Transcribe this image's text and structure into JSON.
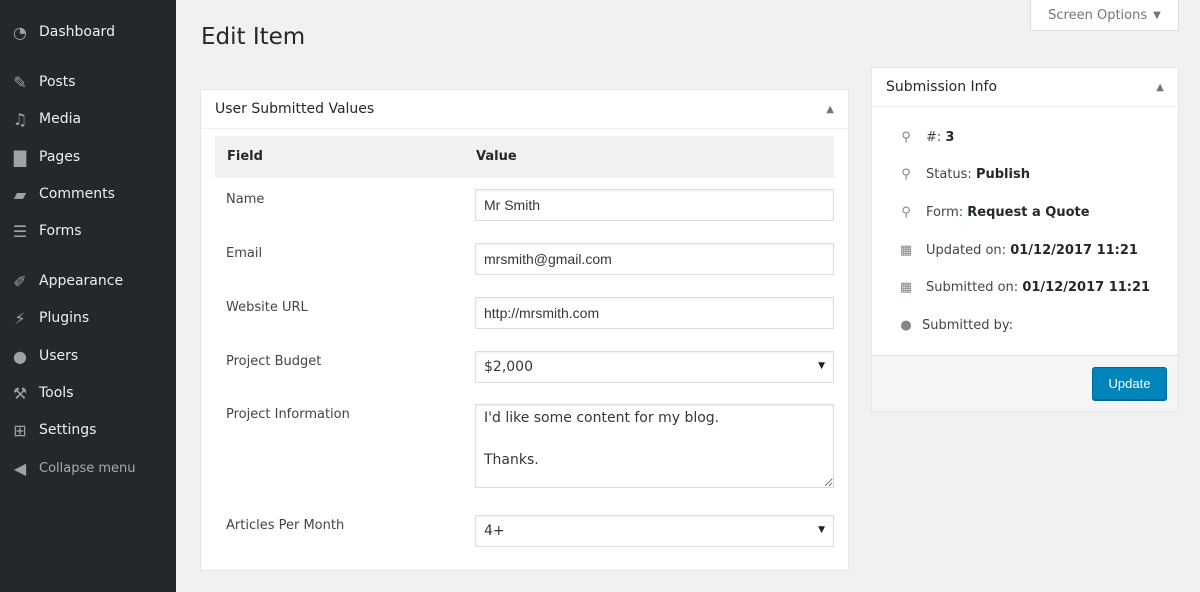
{
  "sidebar": {
    "items": [
      {
        "label": "Dashboard",
        "icon": "dashboard-icon"
      },
      {
        "label": "Posts",
        "icon": "pin-icon"
      },
      {
        "label": "Media",
        "icon": "media-icon"
      },
      {
        "label": "Pages",
        "icon": "pages-icon"
      },
      {
        "label": "Comments",
        "icon": "comment-icon"
      },
      {
        "label": "Forms",
        "icon": "forms-icon"
      },
      {
        "label": "Appearance",
        "icon": "brush-icon"
      },
      {
        "label": "Plugins",
        "icon": "plug-icon"
      },
      {
        "label": "Users",
        "icon": "user-icon"
      },
      {
        "label": "Tools",
        "icon": "wrench-icon"
      },
      {
        "label": "Settings",
        "icon": "settings-icon"
      }
    ],
    "collapse": "Collapse menu"
  },
  "page_title": "Edit Item",
  "screen_options": "Screen Options",
  "main": {
    "title": "User Submitted Values",
    "col_field": "Field",
    "col_value": "Value",
    "fields": [
      {
        "label": "Name",
        "value": "Mr Smith"
      },
      {
        "label": "Email",
        "value": "mrsmith@gmail.com"
      },
      {
        "label": "Website URL",
        "value": "http://mrsmith.com"
      },
      {
        "label": "Project Budget",
        "value": "$2,000"
      },
      {
        "label": "Project Information",
        "value": "I'd like some content for my blog.\n\nThanks."
      },
      {
        "label": "Articles Per Month",
        "value": "4+"
      }
    ]
  },
  "info": {
    "title": "Submission Info",
    "id_label": "#:",
    "id_value": "3",
    "status_label": "Status:",
    "status_value": "Publish",
    "form_label": "Form:",
    "form_value": "Request a Quote",
    "updated_label": "Updated on:",
    "updated_value": "01/12/2017 11:21",
    "submitted_label": "Submitted on:",
    "submitted_value": "01/12/2017 11:21",
    "by_label": "Submitted by:",
    "update_button": "Update"
  },
  "colors": {
    "sidebar": "#23282d",
    "primary": "#0085ba"
  }
}
